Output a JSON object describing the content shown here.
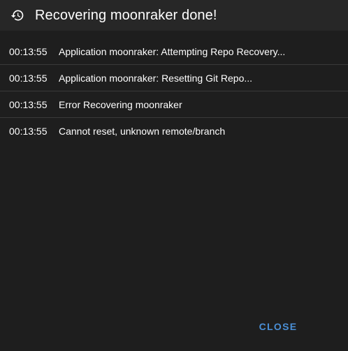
{
  "dialog": {
    "title": "Recovering moonraker done!",
    "icon": "history-icon",
    "close_label": "CLOSE",
    "accent_color": "#4a8fd6"
  },
  "log": [
    {
      "time": "00:13:55",
      "message": "Application moonraker: Attempting Repo Recovery..."
    },
    {
      "time": "00:13:55",
      "message": "Application moonraker: Resetting Git Repo..."
    },
    {
      "time": "00:13:55",
      "message": "Error Recovering moonraker"
    },
    {
      "time": "00:13:55",
      "message": "Cannot reset, unknown remote/branch"
    }
  ]
}
